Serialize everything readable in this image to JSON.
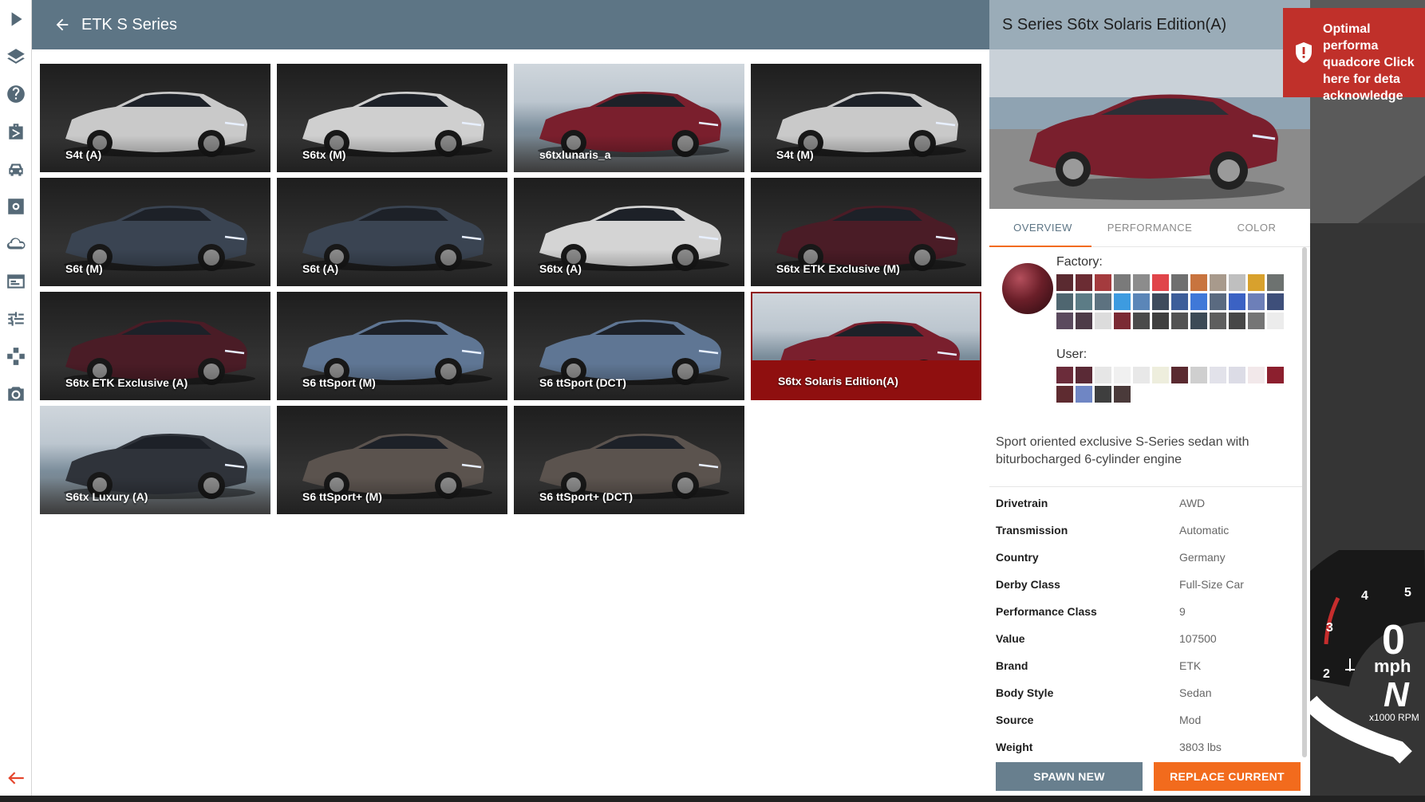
{
  "header": {
    "title": "ETK S Series"
  },
  "tiles": [
    {
      "label": "S4t (A)",
      "color": "#c9c9c9",
      "scene": false
    },
    {
      "label": "S6tx (M)",
      "color": "#cfcfcf",
      "scene": false
    },
    {
      "label": "s6txlunaris_a",
      "color": "#7a1f2d",
      "scene": true
    },
    {
      "label": "S4t (M)",
      "color": "#c9c9c9",
      "scene": false
    },
    {
      "label": "S6t (M)",
      "color": "#3a4452",
      "scene": false
    },
    {
      "label": "S6t (A)",
      "color": "#3a4452",
      "scene": false
    },
    {
      "label": "S6tx (A)",
      "color": "#d4d4d4",
      "scene": false
    },
    {
      "label": "S6tx ETK Exclusive (M)",
      "color": "#4a1c26",
      "scene": false
    },
    {
      "label": "S6tx ETK Exclusive (A)",
      "color": "#4a1c26",
      "scene": false
    },
    {
      "label": "S6 ttSport (M)",
      "color": "#5f7694",
      "scene": false
    },
    {
      "label": "S6 ttSport (DCT)",
      "color": "#5f7694",
      "scene": false
    },
    {
      "label": "S6tx Solaris Edition(A)",
      "color": "#7a1f2d",
      "scene": true,
      "selected": true
    },
    {
      "label": "S6tx Luxury (A)",
      "color": "#2f333a",
      "scene": true
    },
    {
      "label": "S6 ttSport+ (M)",
      "color": "#5b534e",
      "scene": false
    },
    {
      "label": "S6 ttSport+ (DCT)",
      "color": "#5b534e",
      "scene": false
    }
  ],
  "detail": {
    "title": "S Series S6tx Solaris Edition(A)",
    "tabs": [
      "OVERVIEW",
      "PERFORMANCE",
      "COLOR"
    ],
    "factory_label": "Factory:",
    "user_label": "User:",
    "factory_swatches": [
      "#5a2a30",
      "#6b2c33",
      "#a43b3e",
      "#7a7a7a",
      "#8c8c8c",
      "#e0454a",
      "#6f6f6f",
      "#c8743f",
      "#a89a8c",
      "#bfbfbf",
      "#d8a12d",
      "#6d7270",
      "#4f6670",
      "#5c7c86",
      "#5d7280",
      "#3d9be0",
      "#5b86b8",
      "#3f4b5c",
      "#3d5e9a",
      "#3f78d8",
      "#5a6a80",
      "#3b62c4",
      "#6d7fb8",
      "#3e4f7a",
      "#5b4a5e",
      "#4d3b48",
      "#dcdcdc",
      "#7b2a34",
      "#4a4a4a",
      "#3f3f3f",
      "#535353",
      "#3c4a56",
      "#5e5e5e",
      "#474747",
      "#757575",
      "#ececec"
    ],
    "user_swatches": [
      "#6b2c3a",
      "#5a2a36",
      "#e6e6e6",
      "#f0f0f0",
      "#e8e8e8",
      "#eeeedd",
      "#5a2a30",
      "#cfcfcf",
      "#e2e2ea",
      "#dcdce6",
      "#f2e8ea",
      "#8c1f2e",
      "#5e2b30",
      "#6f86c4",
      "#3e3e3e",
      "#4a3a3a"
    ],
    "description": "Sport oriented exclusive S-Series sedan with biturbocharged 6-cylinder engine",
    "specs": [
      {
        "key": "Drivetrain",
        "value": "AWD"
      },
      {
        "key": "Transmission",
        "value": "Automatic"
      },
      {
        "key": "Country",
        "value": "Germany"
      },
      {
        "key": "Derby Class",
        "value": "Full-Size Car"
      },
      {
        "key": "Performance Class",
        "value": "9"
      },
      {
        "key": "Value",
        "value": "107500"
      },
      {
        "key": "Brand",
        "value": "ETK"
      },
      {
        "key": "Body Style",
        "value": "Sedan"
      },
      {
        "key": "Source",
        "value": "Mod"
      },
      {
        "key": "Weight",
        "value": "3803 lbs"
      }
    ],
    "buttons": {
      "spawn": "SPAWN NEW",
      "replace": "REPLACE CURRENT"
    }
  },
  "notice": {
    "text": "Optimal performa quadcore Click here for deta acknowledge"
  },
  "gauge": {
    "speed": "0",
    "unit": "mph",
    "gear": "N",
    "rpm_label": "x1000 RPM",
    "ticks": [
      "2",
      "3",
      "4",
      "5"
    ]
  },
  "rail_icons": [
    "play-icon",
    "layers-icon",
    "help-icon",
    "suitcase-icon",
    "car-icon",
    "settings-icon",
    "cloud-icon",
    "window-icon",
    "sliders-icon",
    "gamepad-icon",
    "camera-icon"
  ]
}
